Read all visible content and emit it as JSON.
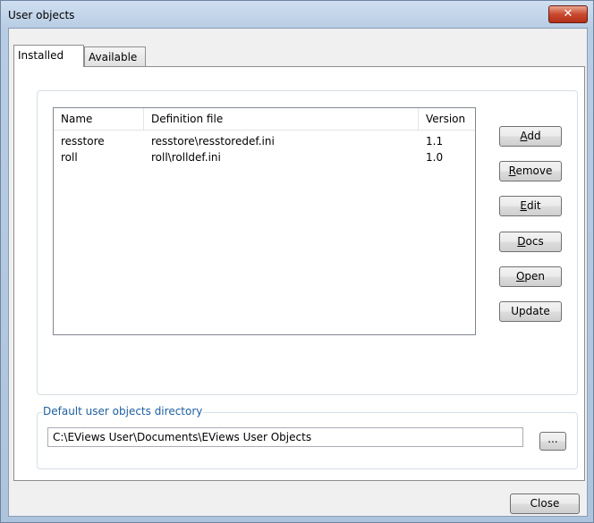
{
  "window": {
    "title": "User objects",
    "close_glyph": "✕"
  },
  "tabs": [
    {
      "label": "Installed",
      "active": true
    },
    {
      "label": "Available",
      "active": false
    }
  ],
  "objects_table": {
    "columns": [
      "Name",
      "Definition file",
      "Version"
    ],
    "rows": [
      {
        "name": "resstore",
        "definition_file": "resstore\\resstoredef.ini",
        "version": "1.1"
      },
      {
        "name": "roll",
        "definition_file": "roll\\rolldef.ini",
        "version": "1.0"
      }
    ]
  },
  "buttons": {
    "add": "Add",
    "add_key": "A",
    "remove": "Remove",
    "remove_key": "R",
    "edit": "Edit",
    "edit_key": "E",
    "docs": "Docs",
    "docs_key": "D",
    "open": "Open",
    "open_key": "O",
    "update": "Update",
    "browse": "...",
    "close": "Close"
  },
  "default_directory": {
    "label": "Default user objects directory",
    "value": "C:\\EViews User\\Documents\\EViews User Objects"
  },
  "colors": {
    "group_label": "#1e5fa0",
    "close_button": "#c9492e"
  }
}
